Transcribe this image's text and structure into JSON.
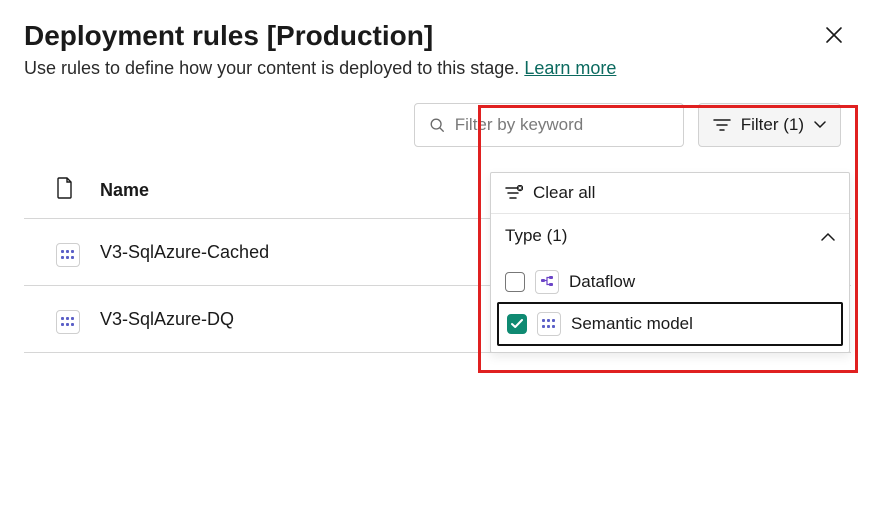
{
  "header": {
    "title": "Deployment rules [Production]",
    "subtitle_prefix": "Use rules to define how your content is deployed to this stage.",
    "learn_more": "Learn more"
  },
  "toolbar": {
    "search_placeholder": "Filter by keyword",
    "filter_button": "Filter (1)"
  },
  "table": {
    "col_name": "Name",
    "rows": [
      {
        "type_icon": "semantic-model-icon",
        "name": "V3-SqlAzure-Cached"
      },
      {
        "type_icon": "semantic-model-icon",
        "name": "V3-SqlAzure-DQ"
      }
    ]
  },
  "filter_panel": {
    "clear_all": "Clear all",
    "section_label": "Type (1)",
    "options": [
      {
        "label": "Dataflow",
        "checked": false,
        "icon": "dataflow-icon"
      },
      {
        "label": "Semantic model",
        "checked": true,
        "icon": "semantic-model-icon"
      }
    ]
  },
  "colors": {
    "accent": "#0f8a72",
    "callout_border": "#e02020"
  }
}
